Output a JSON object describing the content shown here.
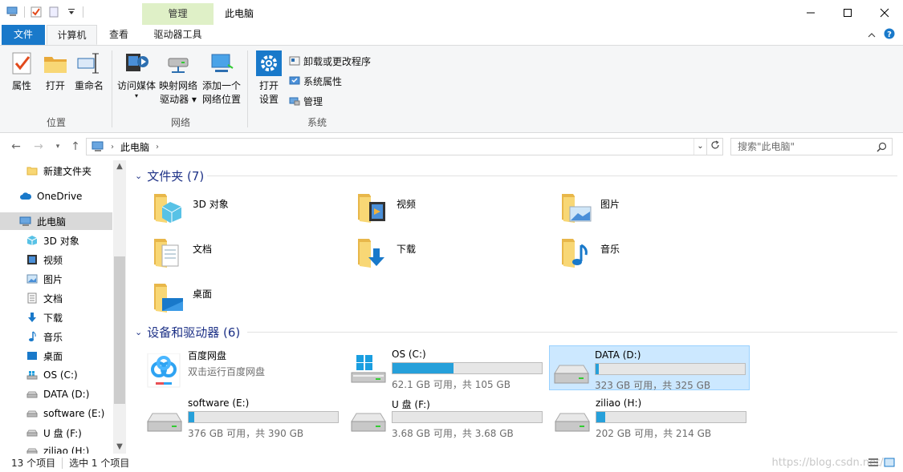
{
  "titlebar": {
    "manage_tab": "管理",
    "window_title": "此电脑"
  },
  "tabs": {
    "file": "文件",
    "computer": "计算机",
    "view": "查看",
    "drive_tools": "驱动器工具"
  },
  "ribbon": {
    "groups": {
      "location": "位置",
      "network": "网络",
      "system": "系统"
    },
    "buttons": {
      "properties": "属性",
      "open": "打开",
      "rename": "重命名",
      "media_1": "访问媒体",
      "map_1": "映射网络",
      "map_2": "驱动器",
      "add_1": "添加一个",
      "add_2": "网络位置",
      "settings_1": "打开",
      "settings_2": "设置",
      "uninstall": "卸载或更改程序",
      "sysprops": "系统属性",
      "manage": "管理"
    }
  },
  "address": {
    "path": "此电脑",
    "search_placeholder": "搜索\"此电脑\""
  },
  "sidebar": {
    "items": [
      {
        "label": "新建文件夹"
      },
      {
        "label": "OneDrive"
      },
      {
        "label": "此电脑"
      },
      {
        "label": "3D 对象"
      },
      {
        "label": "视频"
      },
      {
        "label": "图片"
      },
      {
        "label": "文档"
      },
      {
        "label": "下载"
      },
      {
        "label": "音乐"
      },
      {
        "label": "桌面"
      },
      {
        "label": "OS (C:)"
      },
      {
        "label": "DATA (D:)"
      },
      {
        "label": "software (E:)"
      },
      {
        "label": "U 盘 (F:)"
      },
      {
        "label": "ziliao (H:)"
      }
    ]
  },
  "folders_section": {
    "title": "文件夹 (7)",
    "items": [
      {
        "label": "3D 对象"
      },
      {
        "label": "视频"
      },
      {
        "label": "图片"
      },
      {
        "label": "文档"
      },
      {
        "label": "下载"
      },
      {
        "label": "音乐"
      },
      {
        "label": "桌面"
      }
    ]
  },
  "drives_section": {
    "title": "设备和驱动器 (6)",
    "baidu": {
      "name": "百度网盘",
      "sub": "双击运行百度网盘"
    },
    "drives": [
      {
        "name": "OS (C:)",
        "size": "62.1 GB 可用，共 105 GB",
        "used_fraction": 0.41
      },
      {
        "name": "DATA (D:)",
        "size": "323 GB 可用，共 325 GB",
        "used_fraction": 0.01
      },
      {
        "name": "software (E:)",
        "size": "376 GB 可用，共 390 GB",
        "used_fraction": 0.04
      },
      {
        "name": "U 盘 (F:)",
        "size": "3.68 GB 可用，共 3.68 GB",
        "used_fraction": 0.0
      },
      {
        "name": "ziliao (H:)",
        "size": "202 GB 可用，共 214 GB",
        "used_fraction": 0.06
      }
    ]
  },
  "statusbar": {
    "count": "13 个项目",
    "selected": "选中 1 个项目",
    "watermark": "https://blog.csdn.net/..."
  },
  "colors": {
    "accent": "#1979ca",
    "drive_bar": "#26a0da",
    "manage_tab": "#dff0c7",
    "selection": "#cce8ff"
  }
}
